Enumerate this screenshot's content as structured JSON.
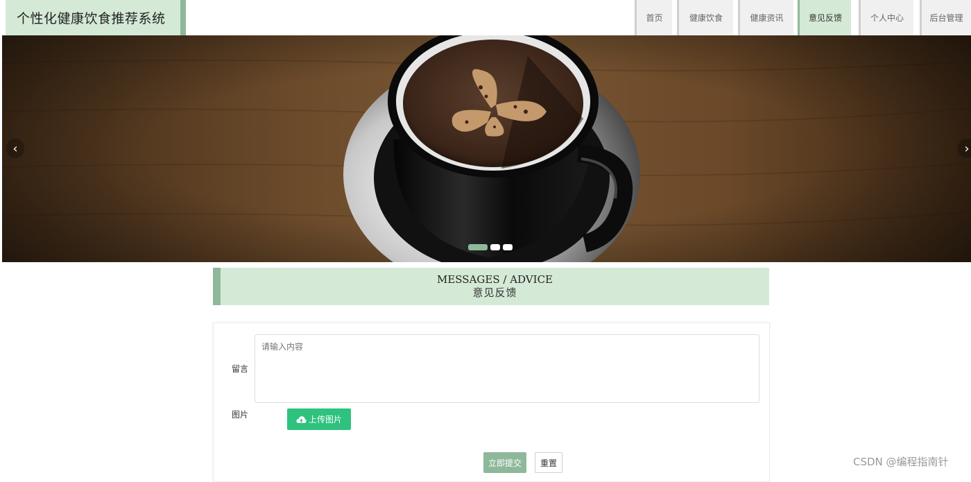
{
  "header": {
    "brand": "个性化健康饮食推荐系统",
    "nav": [
      {
        "label": "首页",
        "active": false
      },
      {
        "label": "健康饮食",
        "active": false
      },
      {
        "label": "健康资讯",
        "active": false
      },
      {
        "label": "意见反馈",
        "active": true
      },
      {
        "label": "个人中心",
        "active": false
      },
      {
        "label": "后台管理",
        "active": false
      }
    ]
  },
  "banner": {
    "prev_icon": "chevron-left-icon",
    "next_icon": "chevron-right-icon",
    "prev_glyph": "‹",
    "next_glyph": "›",
    "slide_count": 3,
    "active_slide": 0
  },
  "section": {
    "title_en": "MESSAGES / ADVICE",
    "title_cn": "意见反馈"
  },
  "form": {
    "message_label": "留言",
    "message_placeholder": "请输入内容",
    "image_label": "图片",
    "upload_label": "上传图片",
    "upload_icon": "cloud-upload-icon",
    "submit_label": "立即提交",
    "reset_label": "重置"
  },
  "watermark": "CSDN @编程指南针",
  "colors": {
    "accent_light": "#d4e9d6",
    "accent_dark": "#8fb89a",
    "upload_green": "#2ec27e"
  }
}
